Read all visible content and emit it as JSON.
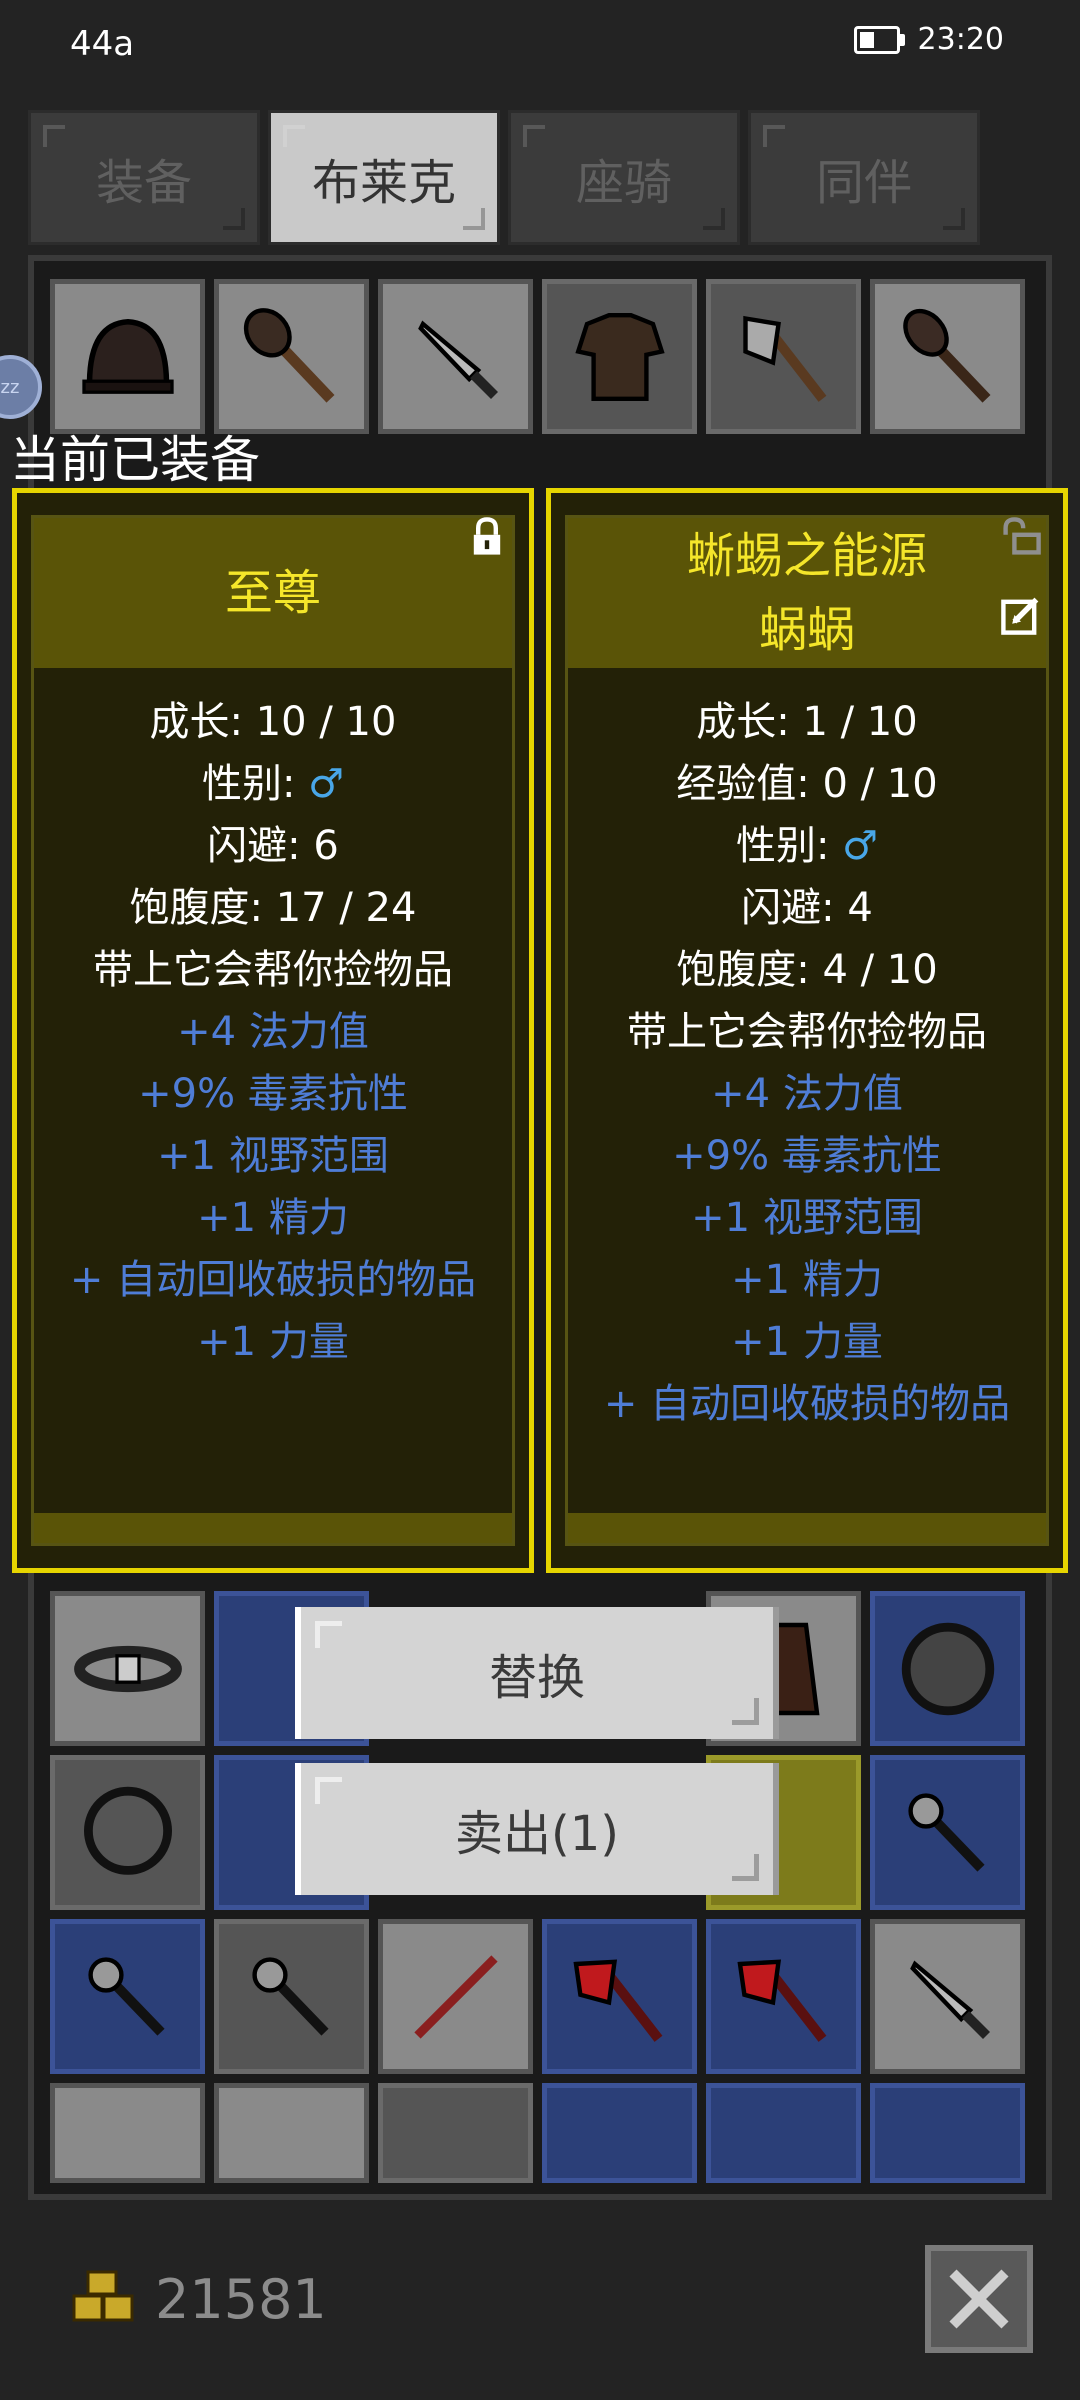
{
  "status_bar": {
    "left_text": "44a",
    "time": "23:20"
  },
  "tabs": [
    {
      "label": "装备",
      "active": false
    },
    {
      "label": "布莱克",
      "active": true
    },
    {
      "label": "座骑",
      "active": false
    },
    {
      "label": "同伴",
      "active": false
    }
  ],
  "current_equipped_label": "当前已装备",
  "sleep_badge": "zz",
  "left_card": {
    "title": "至尊",
    "lock_icon": "lock-icon",
    "stats": [
      {
        "label": "成长: 10 / 10"
      },
      {
        "label": "性别: ",
        "symbol": "♂"
      },
      {
        "label": "闪避: 6"
      },
      {
        "label": "饱腹度: 17 / 24"
      },
      {
        "label": "带上它会帮你捡物品"
      }
    ],
    "buffs": [
      "+4 法力值",
      "+9% 毒素抗性",
      "+1 视野范围",
      "+1 精力",
      "+ 自动回收破损的物品",
      "+1 力量"
    ]
  },
  "right_card": {
    "title_line1": "蜥蜴之能源",
    "title_line2": "蜗蜗",
    "unlock_icon": "unlock-icon",
    "edit_icon": "edit-icon",
    "stats": [
      {
        "label": "成长: 1 / 10"
      },
      {
        "label": "经验值: 0 / 10"
      },
      {
        "label": "性别: ",
        "symbol": "♂"
      },
      {
        "label": "闪避: 4"
      },
      {
        "label": "饱腹度: 4 / 10"
      },
      {
        "label": "带上它会帮你捡物品"
      }
    ],
    "buffs": [
      "+4 法力值",
      "+9% 毒素抗性",
      "+1 视野范围",
      "+1 精力",
      "+1 力量",
      "+ 自动回收破损的物品"
    ]
  },
  "actions": {
    "replace_label": "替换",
    "sell_label": "卖出(1)"
  },
  "footer": {
    "gold_amount": "21581"
  },
  "colors": {
    "accent_yellow": "#e6d500",
    "buff_blue": "#4f7dd6",
    "male_blue": "#49a7e8"
  }
}
